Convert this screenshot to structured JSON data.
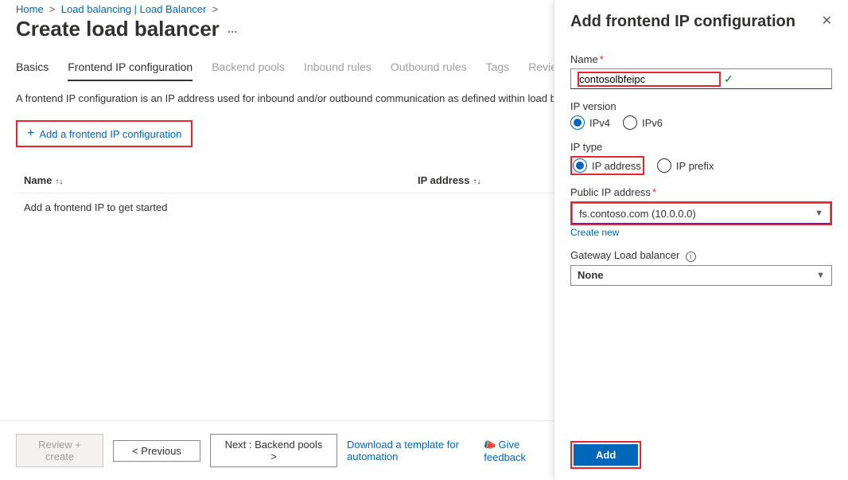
{
  "breadcrumb": {
    "home": "Home",
    "lb": "Load balancing | Load Balancer"
  },
  "page_title": "Create load balancer",
  "tabs": {
    "basics": "Basics",
    "frontend": "Frontend IP configuration",
    "backend": "Backend pools",
    "inbound": "Inbound rules",
    "outbound": "Outbound rules",
    "tags": "Tags",
    "review": "Review + create"
  },
  "description": "A frontend IP configuration is an IP address used for inbound and/or outbound communication as defined within load balancing, inbound NAT, and outbound rules.",
  "add_fe_btn": "Add a frontend IP configuration",
  "table": {
    "col_name": "Name",
    "col_ip": "IP address",
    "empty": "Add a frontend IP to get started"
  },
  "footer": {
    "review": "Review + create",
    "prev": "< Previous",
    "next": "Next : Backend pools >",
    "download": "Download a template for automation",
    "feedback": "Give feedback"
  },
  "panel": {
    "title": "Add frontend IP configuration",
    "name_label": "Name",
    "name_value": "contosolbfeipc",
    "ipver_label": "IP version",
    "ipv4": "IPv4",
    "ipv6": "IPv6",
    "iptype_label": "IP type",
    "ipaddr": "IP address",
    "ipprefix": "IP prefix",
    "pubip_label": "Public IP address",
    "pubip_value": "fs.contoso.com (10.0.0.0)",
    "create_new": "Create new",
    "gateway_label": "Gateway Load balancer",
    "gateway_value": "None",
    "add_btn": "Add"
  }
}
